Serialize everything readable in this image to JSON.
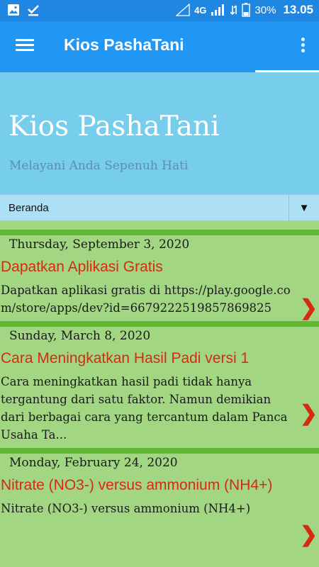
{
  "status_bar": {
    "network": "4G",
    "battery": "30%",
    "time": "13.05",
    "icons": [
      "image-icon",
      "download-done-icon",
      "signal-icon",
      "wifi-icon",
      "battery-icon"
    ]
  },
  "app_bar": {
    "title": "Kios PashaTani",
    "menu_icon": "hamburger-icon",
    "overflow_icon": "more-vert-icon"
  },
  "blog_header": {
    "title": "Kios PashaTani",
    "subtitle": "Melayani Anda Sepenuh Hati"
  },
  "nav_select": {
    "selected": "Beranda",
    "arrow": "▼"
  },
  "posts": [
    {
      "date": "Thursday, September 3, 2020",
      "title": "Dapatkan Aplikasi Gratis",
      "snippet": "Dapatkan aplikasi gratis di https://play.google.com/store/apps/dev?id=6679222519857869825"
    },
    {
      "date": "Sunday, March 8, 2020",
      "title": "Cara Meningkatkan Hasil Padi versi 1",
      "snippet": "Cara meningkatkan hasil padi tidak hanya tergantung dari satu faktor. Namun demikian dari berbagai cara yang tercantum dalam Panca Usaha Ta..."
    },
    {
      "date": "Monday, February 24, 2020",
      "title": "Nitrate (NO3-) versus ammonium (NH4+)",
      "snippet": "Nitrate (NO3-) versus ammonium (NH4+)"
    }
  ],
  "colors": {
    "status_bar": "#1f87e1",
    "app_bar": "#2196f3",
    "header": "#76cdec",
    "content_bg": "#a2d683",
    "post_divider": "#62b631",
    "post_title": "#d62b10"
  }
}
